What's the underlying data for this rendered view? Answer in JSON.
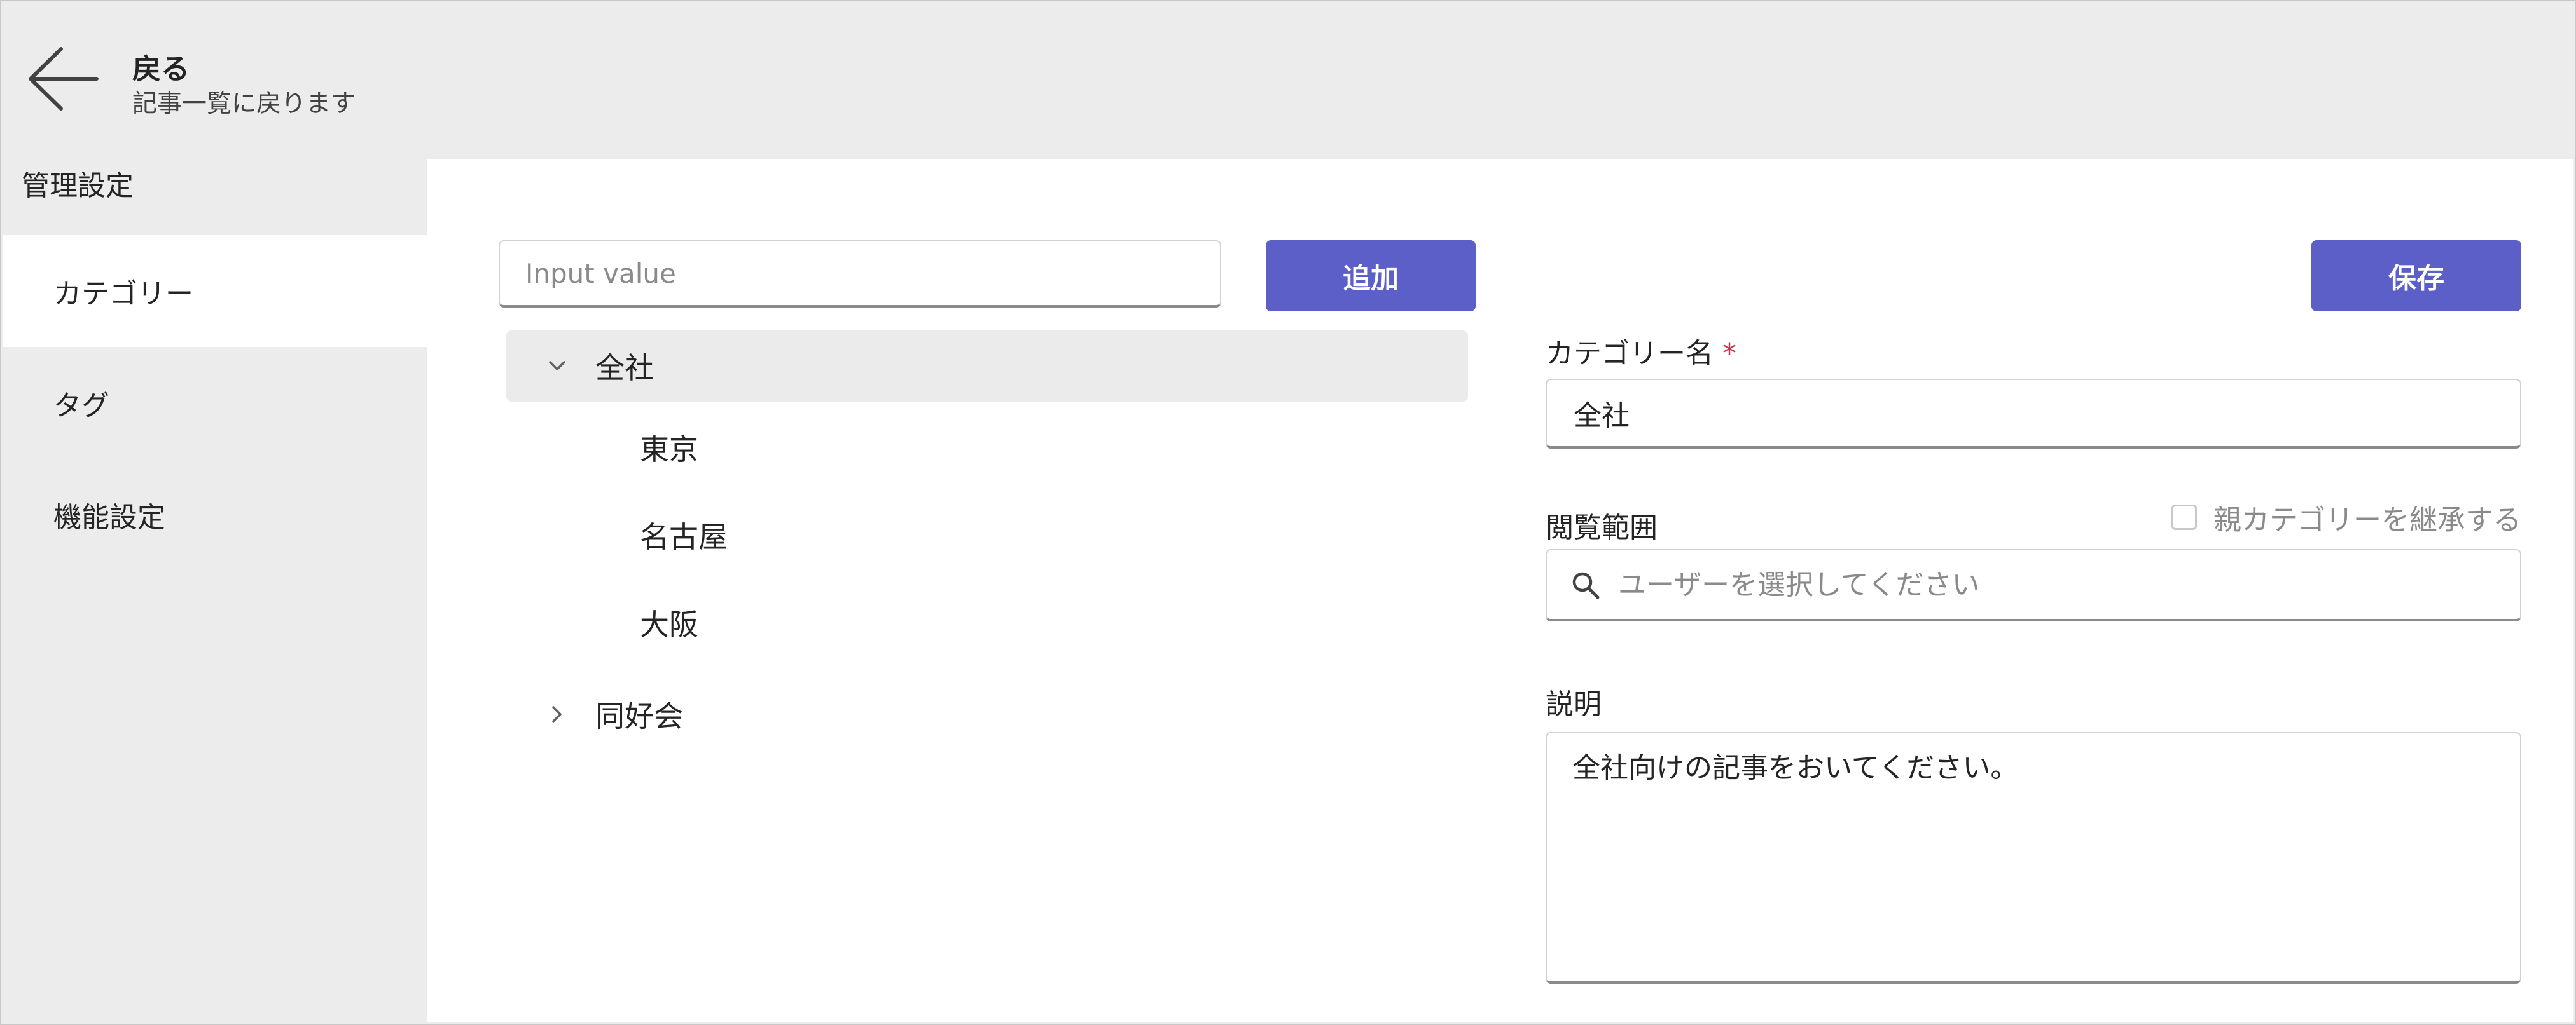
{
  "header": {
    "back_title": "戻る",
    "back_subtitle": "記事一覧に戻ります",
    "back_icon": "arrow-left-icon"
  },
  "sidebar": {
    "heading": "管理設定",
    "items": [
      {
        "label": "カテゴリー",
        "active": true
      },
      {
        "label": "タグ",
        "active": false
      },
      {
        "label": "機能設定",
        "active": false
      }
    ]
  },
  "tree": {
    "input_placeholder": "Input value",
    "add_button": "追加",
    "nodes": [
      {
        "label": "全社",
        "expanded": true,
        "selected": true,
        "level": 0
      },
      {
        "label": "東京",
        "level": 1
      },
      {
        "label": "名古屋",
        "level": 1
      },
      {
        "label": "大阪",
        "level": 1
      },
      {
        "label": "同好会",
        "expanded": false,
        "level": 0
      }
    ]
  },
  "form": {
    "save_button": "保存",
    "category_name_label": "カテゴリー名",
    "required_mark": "*",
    "category_name_value": "全社",
    "scope_label": "閲覧範囲",
    "inherit_checkbox_label": "親カテゴリーを継承する",
    "inherit_checked": false,
    "user_search_placeholder": "ユーザーを選択してください",
    "description_label": "説明",
    "description_value": "全社向けの記事をおいてください。"
  },
  "colors": {
    "accent": "#5b5fc7",
    "header_bg": "#ececec",
    "panel_bg": "#ffffff",
    "selected_row": "#ebebeb",
    "required": "#c4314b"
  }
}
